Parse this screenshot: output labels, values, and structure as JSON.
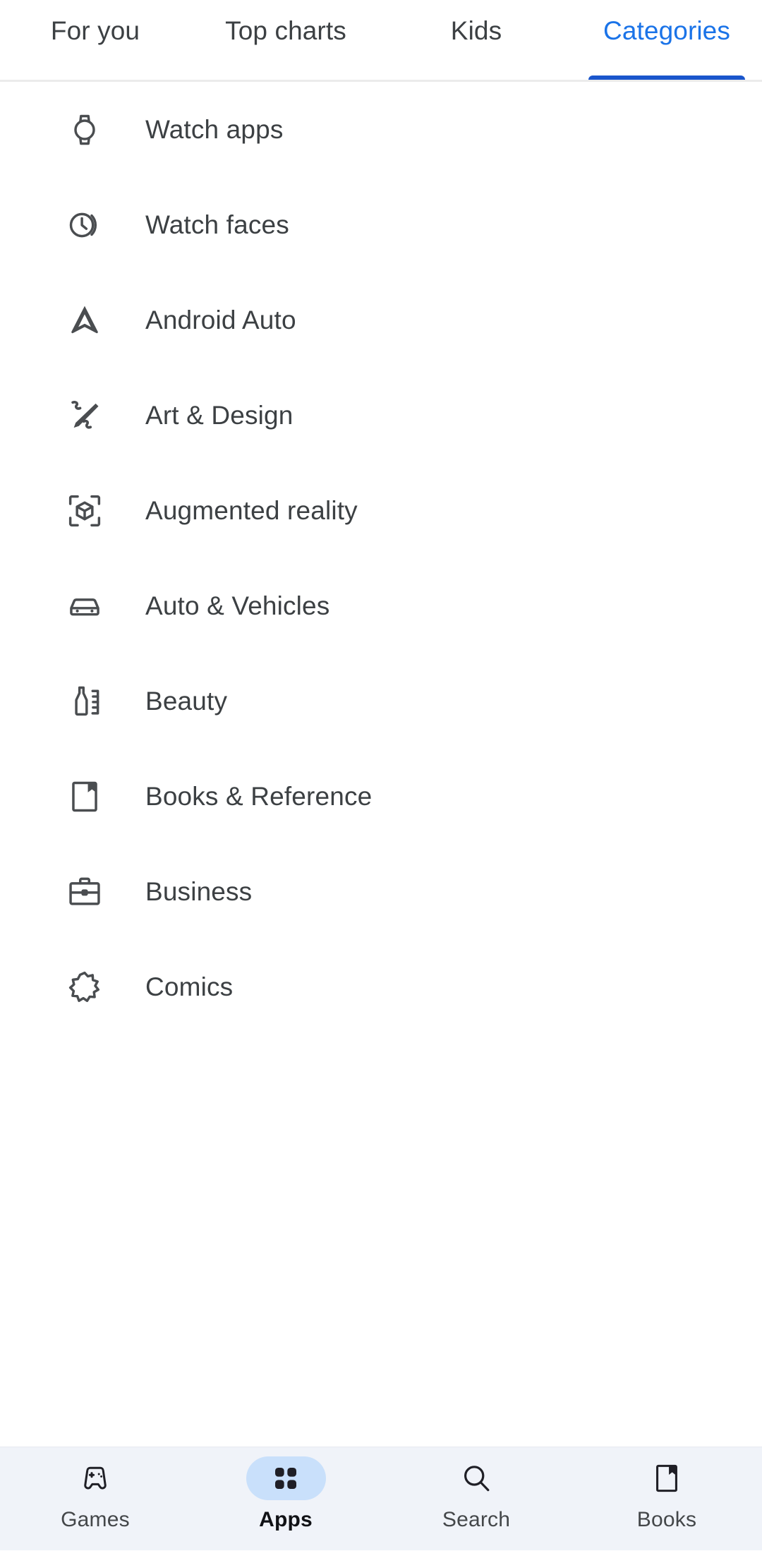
{
  "colors": {
    "accent_blue": "#1a73e8",
    "indicator_blue": "#1a56cc",
    "text_primary": "#3c4043",
    "icon_gray": "#4a4d50",
    "bottom_nav_bg": "#f0f3f9",
    "active_pill": "#c9e0fb",
    "divider": "#ebebeb"
  },
  "tabs": [
    {
      "label": "For you",
      "active": false
    },
    {
      "label": "Top charts",
      "active": false
    },
    {
      "label": "Kids",
      "active": false
    },
    {
      "label": "Categories",
      "active": true
    }
  ],
  "categories": [
    {
      "label": "Watch apps",
      "icon": "watch-icon"
    },
    {
      "label": "Watch faces",
      "icon": "watch-face-clock-icon"
    },
    {
      "label": "Android Auto",
      "icon": "android-auto-icon"
    },
    {
      "label": "Art & Design",
      "icon": "brush-pencil-icon"
    },
    {
      "label": "Augmented reality",
      "icon": "ar-cube-icon"
    },
    {
      "label": "Auto & Vehicles",
      "icon": "car-icon"
    },
    {
      "label": "Beauty",
      "icon": "nail-polish-comb-icon"
    },
    {
      "label": "Books & Reference",
      "icon": "book-bookmark-icon"
    },
    {
      "label": "Business",
      "icon": "briefcase-icon"
    },
    {
      "label": "Comics",
      "icon": "comic-burst-icon"
    }
  ],
  "bottom_nav": [
    {
      "label": "Games",
      "icon": "gamepad-icon",
      "active": false
    },
    {
      "label": "Apps",
      "icon": "apps-grid-icon",
      "active": true
    },
    {
      "label": "Search",
      "icon": "search-icon",
      "active": false
    },
    {
      "label": "Books",
      "icon": "books-icon",
      "active": false
    }
  ]
}
